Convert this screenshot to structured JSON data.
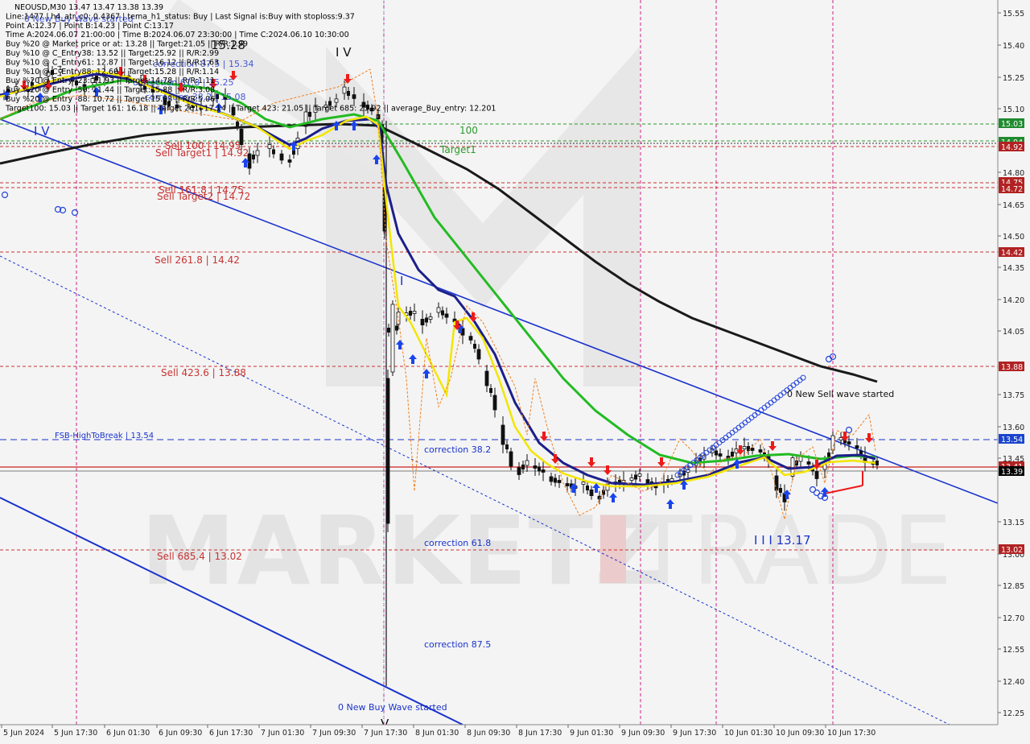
{
  "info_lines": [
    "NEOUSD,M30  13.47 13.47 13.38 13.39",
    "Line:1477 | h4_atr_c0: 0.4367 | tema_h1_status: Buy | Last Signal is:Buy with stoploss:9.37",
    "Point A:12.37 | Point B:14.23 | Point C:13.17",
    "Time A:2024.06.07 21:00:00 | Time B:2024.06.07 23:30:00 | Time C:2024.06.10 10:30:00",
    "Buy %20 @ Market price or at: 13.28 || Target:21.05 || R/R:1.99",
    "Buy %10 @ C_Entry38: 13.52 || Target:25.92 || R/R:2.99",
    "Buy %10 @ C_Entry61: 12.87 || Target:16.12 || R/R:1.63",
    "Buy %10 @ C_Entry88: 12.60 || Target:15.28 || R/R:1.14",
    "Buy %20 @ Entry -23: 11.93 || Target:14.78 || R/R:1.11",
    "Buy %20 @ Entry -50: 11.44 || Target:15.88 || R/R:3.08",
    "Buy %20 @ Entry -88: 10.72 || Target:15.03 || R/R:5.06",
    "Target100: 15.03 || Target 161: 16.18 || Target 261: 17.14 || Target 423: 21.05 || Target 685: 25.92 || average_Buy_entry: 12.201"
  ],
  "price_scale": {
    "ticks": [
      "15.55",
      "15.40",
      "15.25",
      "15.10",
      "14.80",
      "14.65",
      "14.50",
      "14.35",
      "14.20",
      "14.05",
      "13.75",
      "13.60",
      "13.45",
      "13.15",
      "13.00",
      "12.85",
      "12.70",
      "12.55",
      "12.40",
      "12.25"
    ],
    "badges": [
      {
        "text": "15.03",
        "color": "#1f8a2e"
      },
      {
        "text": "14.94",
        "color": "#1f8a2e"
      },
      {
        "text": "14.92",
        "color": "#b22222"
      },
      {
        "text": "14.75",
        "color": "#b22222"
      },
      {
        "text": "14.72",
        "color": "#b22222"
      },
      {
        "text": "14.42",
        "color": "#b22222"
      },
      {
        "text": "13.88",
        "color": "#b22222"
      },
      {
        "text": "13.54",
        "color": "#1a44cc"
      },
      {
        "text": "13.41",
        "color": "#b22222"
      },
      {
        "text": "13.39",
        "color": "#000000"
      },
      {
        "text": "13.02",
        "color": "#b22222"
      }
    ]
  },
  "time_axis": [
    "5 Jun 2024",
    "5 Jun 17:30",
    "6 Jun 01:30",
    "6 Jun 09:30",
    "6 Jun 17:30",
    "7 Jun 01:30",
    "7 Jun 09:30",
    "7 Jun 17:30",
    "8 Jun 01:30",
    "8 Jun 09:30",
    "8 Jun 17:30",
    "9 Jun 01:30",
    "9 Jun 09:30",
    "9 Jun 17:30",
    "10 Jun 01:30",
    "10 Jun 09:30",
    "10 Jun 17:30"
  ],
  "level_labels": {
    "l100": "100",
    "target1": "Target1",
    "sell100": "Sell 100 | 14.95",
    "sell_target1": "Sell Target1 | 14.92",
    "sell161": "Sell 161.8 | 14.75",
    "sell_target2": "Sell Target2 | 14.72",
    "sell261": "Sell  261.8 | 14.42",
    "sell423": "Sell  423.6 | 13.88",
    "fsb": "FSB-HighToBreak | 13.54",
    "sell685": "Sell  685.4 | 13.02",
    "corr38": "correction 38.2",
    "corr61": "correction 61.8",
    "corr87": "correction 87.5"
  },
  "annotations": {
    "wave_iv_top": "I V",
    "wave_iv_left": "I V",
    "wave_v_top": "15.28",
    "wave_i": "I",
    "wave_iii": "I I I 13.17",
    "wave_v_bottom": "V",
    "new_sell": "0 New Sell wave started",
    "new_buy": "0 New Buy Wave started",
    "overlap_a": "0 New Buy Wave started",
    "overlap_b": "correction 87.5 | 15.34",
    "overlap_c": "correction 61.8 | 15.25",
    "overlap_d": "correction 38.2 | 15.08"
  },
  "watermark": {
    "brand": "MARKETZ",
    "suffix": "TRADE"
  },
  "colors": {
    "ma_black": "#1a1a1a",
    "ma_green": "#22bb22",
    "ma_navy": "#1c1f8a",
    "ma_yellow": "#f2e600",
    "trend_blue": "#1a33cc",
    "grid": "#d8d8d8",
    "level_red": "#c83232",
    "level_green": "#2a9a2a",
    "buy_arrow": "#1a44ee",
    "sell_arrow": "#ee1a1a",
    "vline_magenta": "#cc2288"
  }
}
